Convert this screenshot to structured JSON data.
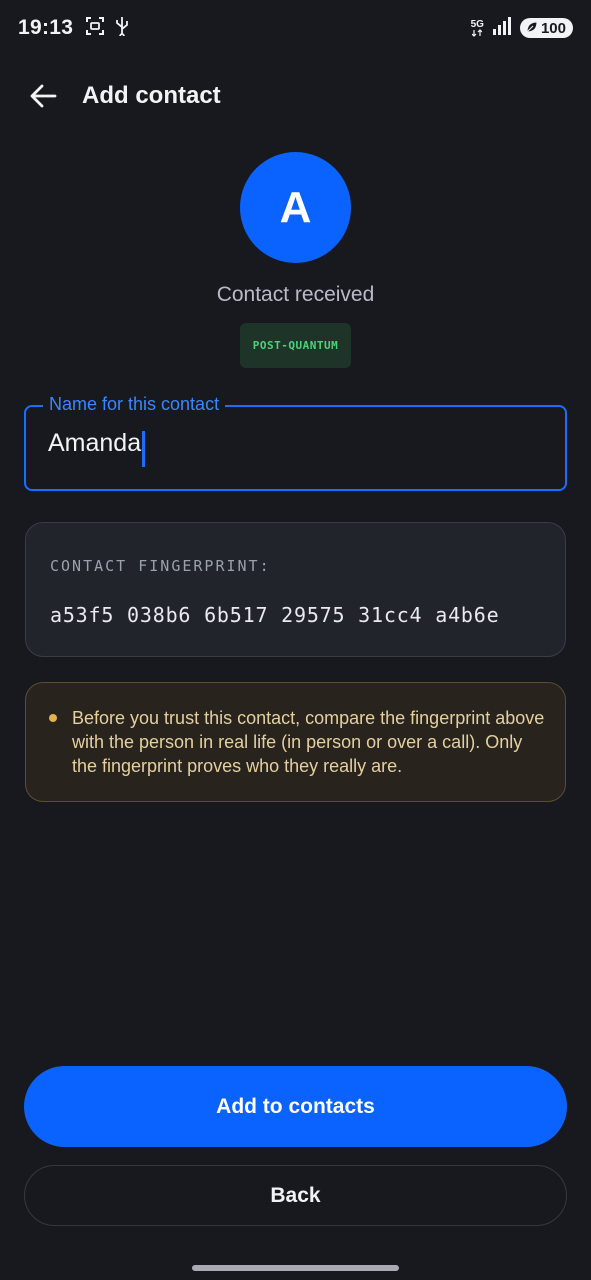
{
  "status_bar": {
    "time": "19:13",
    "network": "5G",
    "battery": "100"
  },
  "app_bar": {
    "title": "Add contact"
  },
  "contact": {
    "avatar_letter": "A",
    "status": "Contact received",
    "badge": "POST-QUANTUM"
  },
  "name_field": {
    "label": "Name for this contact",
    "value": "Amanda"
  },
  "fingerprint": {
    "label": "CONTACT FINGERPRINT:",
    "value": "a53f5 038b6 6b517 29575 31cc4 a4b6e"
  },
  "warning": {
    "text": "Before you trust this contact, compare the fingerprint above with the person in real life (in person or over a call). Only the fingerprint proves who they really are."
  },
  "actions": {
    "primary_label": "Add to contacts",
    "secondary_label": "Back"
  },
  "colors": {
    "background": "#18191f",
    "accent": "#0b63ff",
    "badge_text": "#4fd07a",
    "warning_text": "#e4cf9f"
  }
}
